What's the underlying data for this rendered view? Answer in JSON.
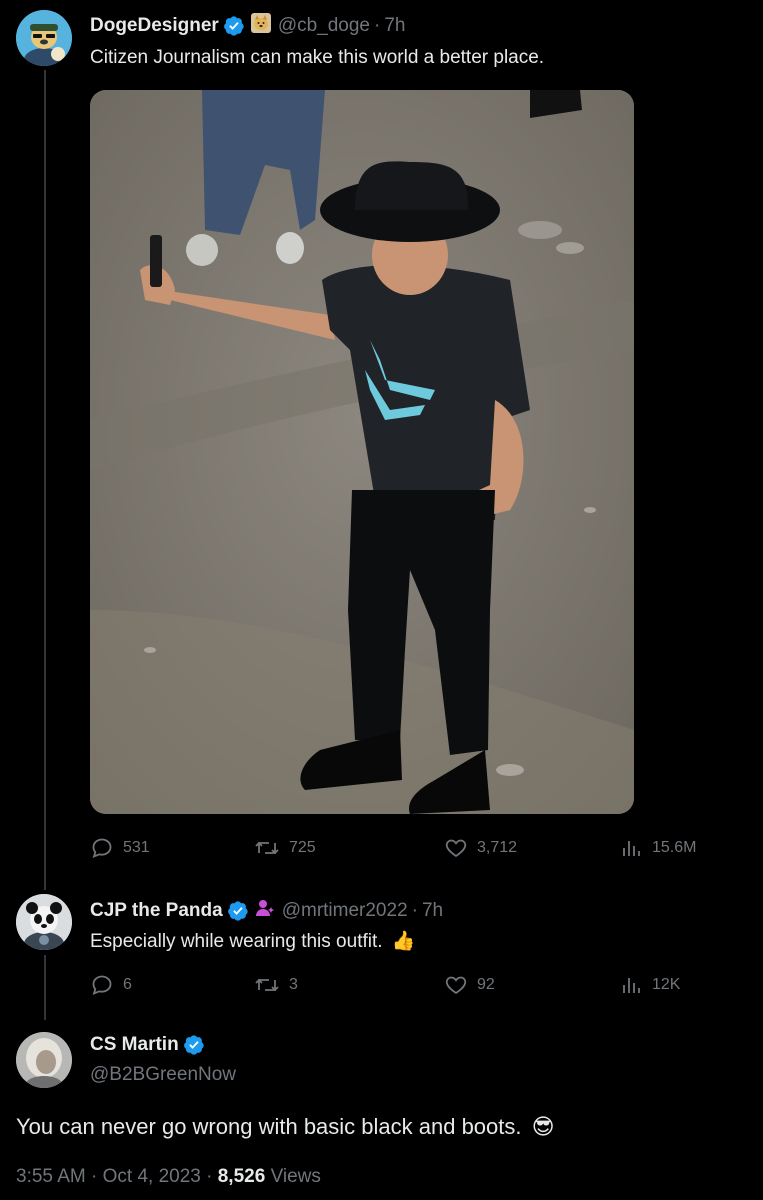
{
  "tweet1": {
    "display_name": "DogeDesigner",
    "handle": "@cb_doge",
    "separator": "·",
    "time": "7h",
    "text": "Citizen Journalism can make this world a better place.",
    "verified_color": "#1d9bf0",
    "stats": {
      "replies": "531",
      "retweets": "725",
      "likes": "3,712",
      "views": "15.6M"
    }
  },
  "tweet2": {
    "display_name": "CJP the Panda",
    "handle": "@mrtimer2022",
    "separator": "·",
    "time": "7h",
    "text": "Especially while wearing this outfit.",
    "emoji": "👍",
    "verified_color": "#1d9bf0",
    "stats": {
      "replies": "6",
      "retweets": "3",
      "likes": "92",
      "views": "12K"
    }
  },
  "tweet3": {
    "display_name": "CS Martin",
    "handle": "@B2BGreenNow",
    "text": "You can never go wrong with basic black and boots.",
    "emoji": "😎",
    "verified_color": "#1d9bf0"
  },
  "footer": {
    "time": "3:55 AM",
    "separator1": "·",
    "date": "Oct 4, 2023",
    "separator2": "·",
    "views_count": "8,526",
    "views_label": "Views"
  },
  "icons": {
    "reply": "reply-icon",
    "retweet": "retweet-icon",
    "like": "heart-icon",
    "views": "analytics-icon",
    "verified": "verified-badge-icon"
  },
  "colors": {
    "background": "#000000",
    "text_primary": "#e7e9ea",
    "text_secondary": "#71767b",
    "accent": "#1d9bf0",
    "thread_line": "#333639"
  }
}
